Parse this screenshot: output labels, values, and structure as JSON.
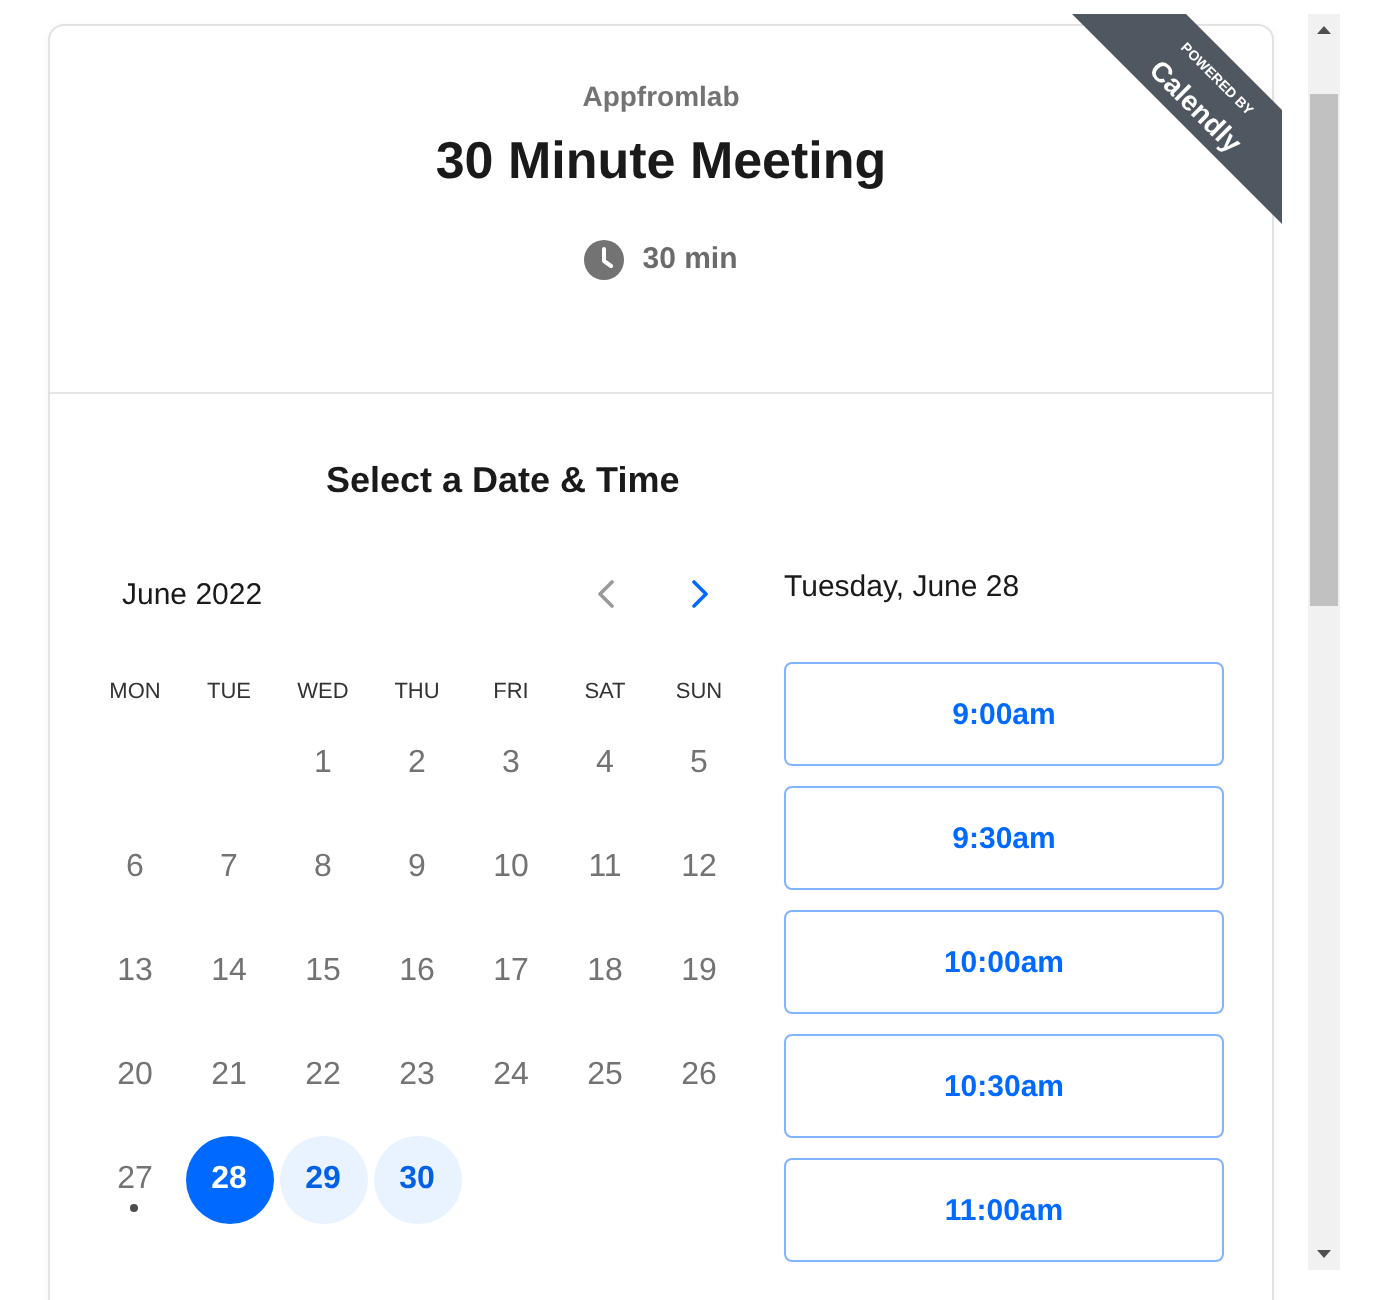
{
  "header": {
    "organizer": "Appfromlab",
    "title": "30 Minute Meeting",
    "duration": "30 min"
  },
  "ribbon": {
    "caption": "POWERED BY",
    "brand": "Calendly"
  },
  "picker": {
    "heading": "Select a Date & Time",
    "month": "June 2022",
    "nav": [
      {
        "kind": "prev",
        "disabled": true
      },
      {
        "kind": "next",
        "disabled": false
      }
    ],
    "weekdays": [
      "MON",
      "TUE",
      "WED",
      "THU",
      "FRI",
      "SAT",
      "SUN"
    ],
    "weeks": [
      [
        {
          "kind": "blank"
        },
        {
          "kind": "blank"
        },
        {
          "kind": "day",
          "day": "1",
          "available": false,
          "selected": false,
          "today": false
        },
        {
          "kind": "day",
          "day": "2",
          "available": false,
          "selected": false,
          "today": false
        },
        {
          "kind": "day",
          "day": "3",
          "available": false,
          "selected": false,
          "today": false
        },
        {
          "kind": "day",
          "day": "4",
          "available": false,
          "selected": false,
          "today": false
        },
        {
          "kind": "day",
          "day": "5",
          "available": false,
          "selected": false,
          "today": false
        }
      ],
      [
        {
          "kind": "day",
          "day": "6",
          "available": false,
          "selected": false,
          "today": false
        },
        {
          "kind": "day",
          "day": "7",
          "available": false,
          "selected": false,
          "today": false
        },
        {
          "kind": "day",
          "day": "8",
          "available": false,
          "selected": false,
          "today": false
        },
        {
          "kind": "day",
          "day": "9",
          "available": false,
          "selected": false,
          "today": false
        },
        {
          "kind": "day",
          "day": "10",
          "available": false,
          "selected": false,
          "today": false
        },
        {
          "kind": "day",
          "day": "11",
          "available": false,
          "selected": false,
          "today": false
        },
        {
          "kind": "day",
          "day": "12",
          "available": false,
          "selected": false,
          "today": false
        }
      ],
      [
        {
          "kind": "day",
          "day": "13",
          "available": false,
          "selected": false,
          "today": false
        },
        {
          "kind": "day",
          "day": "14",
          "available": false,
          "selected": false,
          "today": false
        },
        {
          "kind": "day",
          "day": "15",
          "available": false,
          "selected": false,
          "today": false
        },
        {
          "kind": "day",
          "day": "16",
          "available": false,
          "selected": false,
          "today": false
        },
        {
          "kind": "day",
          "day": "17",
          "available": false,
          "selected": false,
          "today": false
        },
        {
          "kind": "day",
          "day": "18",
          "available": false,
          "selected": false,
          "today": false
        },
        {
          "kind": "day",
          "day": "19",
          "available": false,
          "selected": false,
          "today": false
        }
      ],
      [
        {
          "kind": "day",
          "day": "20",
          "available": false,
          "selected": false,
          "today": false
        },
        {
          "kind": "day",
          "day": "21",
          "available": false,
          "selected": false,
          "today": false
        },
        {
          "kind": "day",
          "day": "22",
          "available": false,
          "selected": false,
          "today": false
        },
        {
          "kind": "day",
          "day": "23",
          "available": false,
          "selected": false,
          "today": false
        },
        {
          "kind": "day",
          "day": "24",
          "available": false,
          "selected": false,
          "today": false
        },
        {
          "kind": "day",
          "day": "25",
          "available": false,
          "selected": false,
          "today": false
        },
        {
          "kind": "day",
          "day": "26",
          "available": false,
          "selected": false,
          "today": false
        }
      ],
      [
        {
          "kind": "day",
          "day": "27",
          "available": false,
          "selected": false,
          "today": true
        },
        {
          "kind": "day",
          "day": "28",
          "available": true,
          "selected": true,
          "today": false
        },
        {
          "kind": "day",
          "day": "29",
          "available": true,
          "selected": false,
          "today": false
        },
        {
          "kind": "day",
          "day": "30",
          "available": true,
          "selected": false,
          "today": false
        }
      ]
    ]
  },
  "times": {
    "date": "Tuesday, June 28",
    "slots": [
      {
        "time": "9:00am",
        "selected": false
      },
      {
        "time": "9:30am",
        "selected": false
      },
      {
        "time": "10:00am",
        "selected": false
      },
      {
        "time": "10:30am",
        "selected": false
      },
      {
        "time": "11:00am",
        "selected": false
      }
    ]
  }
}
